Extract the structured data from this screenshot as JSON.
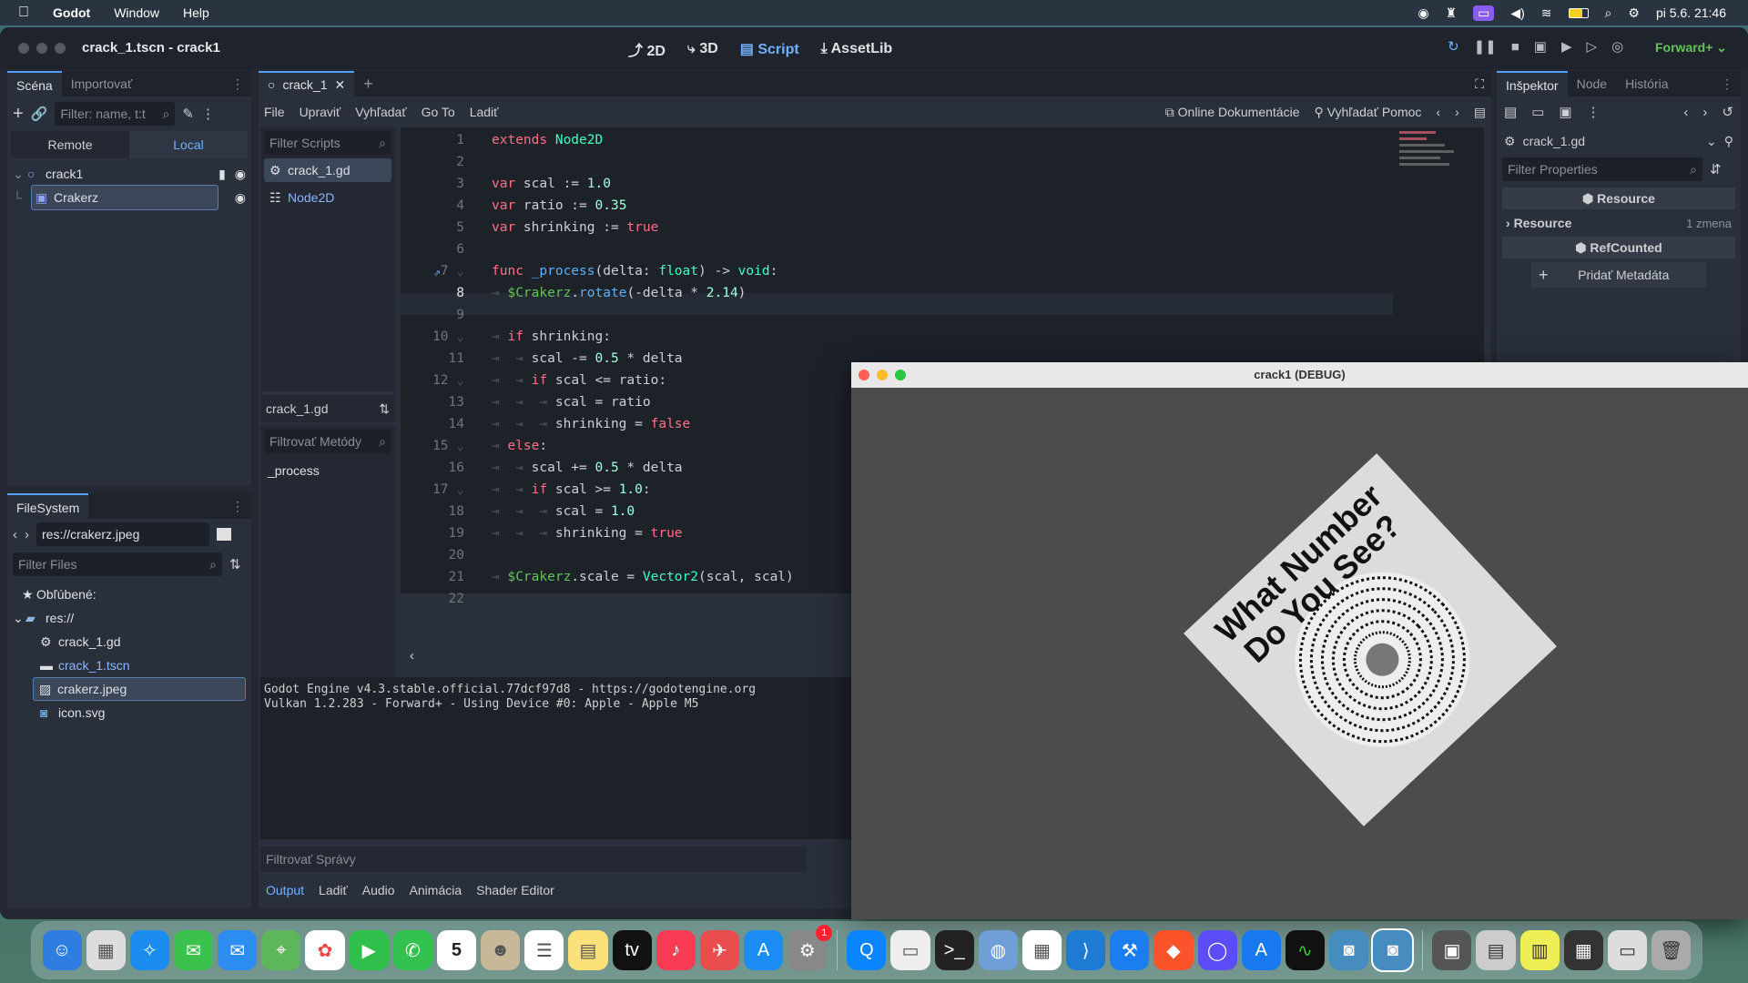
{
  "menubar": {
    "app": "Godot",
    "items": [
      "Window",
      "Help"
    ],
    "clock": "pi 5.6.  21:46"
  },
  "window": {
    "title": "crack_1.tscn - crack1",
    "modes": [
      "2D",
      "3D",
      "Script",
      "AssetLib"
    ],
    "active_mode": "Script",
    "renderer": "Forward+"
  },
  "scene_dock": {
    "tabs": [
      "Scéna",
      "Importovať"
    ],
    "filter_placeholder": "Filter: name, t:t",
    "remote": "Remote",
    "local": "Local",
    "nodes": [
      "crack1",
      "Crakerz"
    ]
  },
  "filesystem": {
    "tab": "FileSystem",
    "path": "res://crakerz.jpeg",
    "filter_placeholder": "Filter Files",
    "favorites": "Obľúbené:",
    "root": "res://",
    "files": [
      "crack_1.gd",
      "crack_1.tscn",
      "crakerz.jpeg",
      "icon.svg"
    ]
  },
  "script_editor": {
    "tab": "crack_1",
    "menus": [
      "File",
      "Upraviť",
      "Vyhľadať",
      "Go To",
      "Ladiť"
    ],
    "online_docs": "Online Dokumentácie",
    "search_help": "Vyhľadať Pomoc",
    "filter_scripts": "Filter Scripts",
    "scripts": [
      "crack_1.gd",
      "Node2D"
    ],
    "current_script": "crack_1.gd",
    "filter_methods": "Filtrovať Metódy",
    "methods": [
      "_process"
    ]
  },
  "output": {
    "lines": [
      "Godot Engine v4.3.stable.official.77dcf97d8 - https://godotengine.org",
      "Vulkan 1.2.283 - Forward+ - Using Device #0: Apple - Apple M5"
    ],
    "filter": "Filtrovať Správy",
    "tabs": [
      "Output",
      "Ladiť",
      "Audio",
      "Animácia",
      "Shader Editor"
    ]
  },
  "inspector": {
    "tabs": [
      "Inšpektor",
      "Node",
      "História"
    ],
    "resource_name": "crack_1.gd",
    "filter_placeholder": "Filter Properties",
    "section_resource": "Resource",
    "prop_resource": "Resource",
    "prop_changes": "1 zmena",
    "section_refcounted": "RefCounted",
    "add_metadata": "Pridať Metadáta"
  },
  "debug_window": {
    "title": "crack1 (DEBUG)",
    "image_text_line1": "What Number",
    "image_text_line2": "Do You See?"
  },
  "dock": {
    "calendar_day": "5",
    "badge": "1"
  }
}
